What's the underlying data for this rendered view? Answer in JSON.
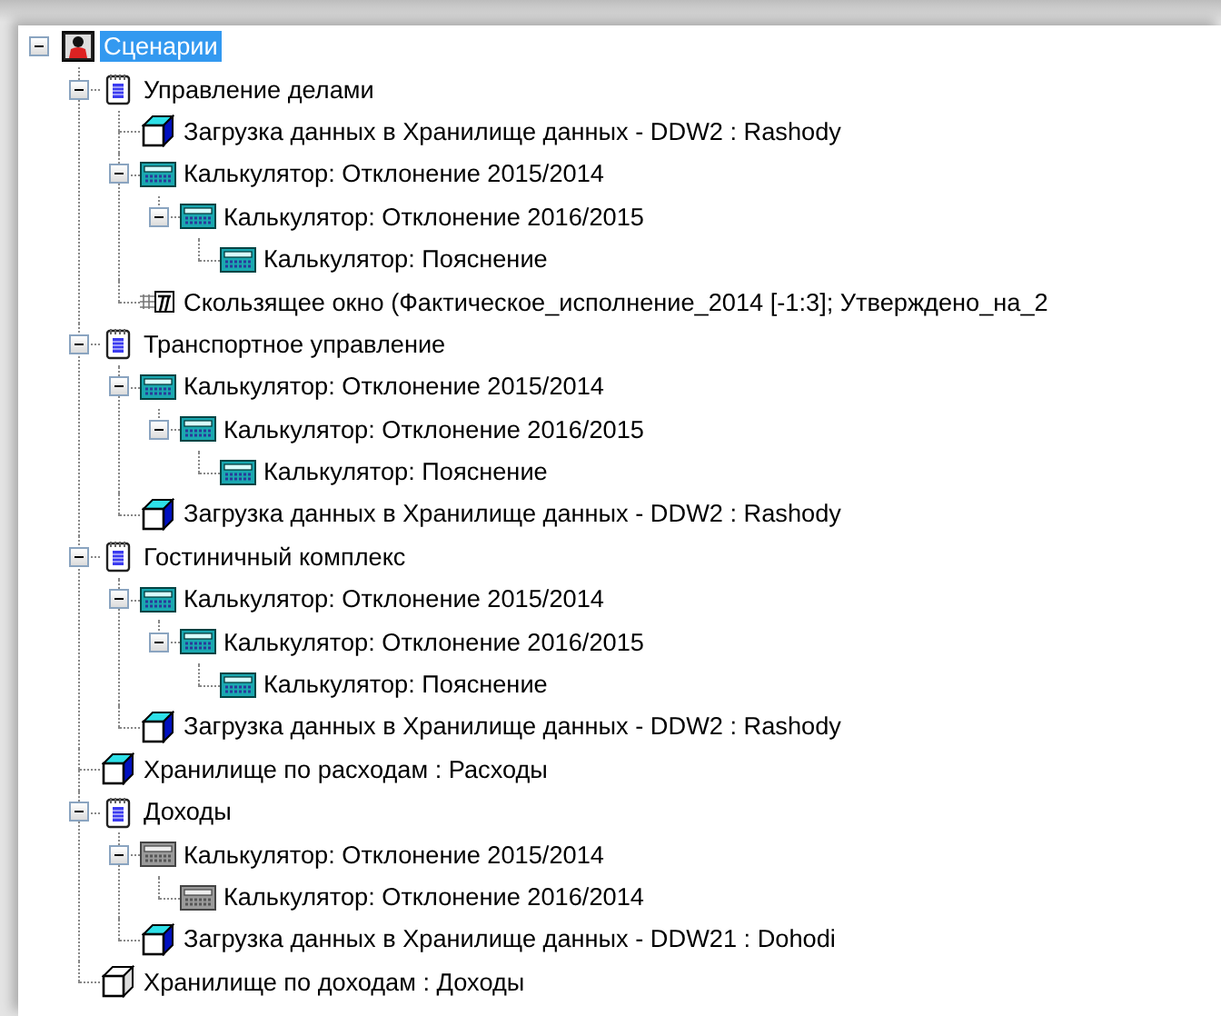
{
  "tree": {
    "nodes": [
      {
        "label": "Сценарии",
        "kind": "root",
        "selected": true,
        "expanded": true,
        "children": [
          {
            "label": "Управление делами",
            "kind": "scenario",
            "selected": false,
            "expanded": true,
            "children": [
              {
                "label": "Загрузка данных в Хранилище данных - DDW2 : Rashody",
                "kind": "cube",
                "selected": false
              },
              {
                "label": "Калькулятор: Отклонение 2015/2014",
                "kind": "calculator",
                "selected": false,
                "expanded": true,
                "children": [
                  {
                    "label": "Калькулятор: Отклонение 2016/2015",
                    "kind": "calculator",
                    "selected": false,
                    "expanded": true,
                    "children": [
                      {
                        "label": "Калькулятор: Пояснение",
                        "kind": "calculator",
                        "selected": false
                      }
                    ]
                  }
                ]
              },
              {
                "label": "Скользящее окно (Фактическое_исполнение_2014 [-1:3]; Утверждено_на_2",
                "kind": "window",
                "selected": false
              }
            ]
          },
          {
            "label": "Транспортное управление",
            "kind": "scenario",
            "selected": false,
            "expanded": true,
            "children": [
              {
                "label": "Калькулятор: Отклонение 2015/2014",
                "kind": "calculator",
                "selected": false,
                "expanded": true,
                "children": [
                  {
                    "label": "Калькулятор: Отклонение 2016/2015",
                    "kind": "calculator",
                    "selected": false,
                    "expanded": true,
                    "children": [
                      {
                        "label": "Калькулятор: Пояснение",
                        "kind": "calculator",
                        "selected": false
                      }
                    ]
                  }
                ]
              },
              {
                "label": "Загрузка данных в Хранилище данных - DDW2 : Rashody",
                "kind": "cube",
                "selected": false
              }
            ]
          },
          {
            "label": "Гостиничный комплекс",
            "kind": "scenario",
            "selected": false,
            "expanded": true,
            "children": [
              {
                "label": "Калькулятор: Отклонение 2015/2014",
                "kind": "calculator",
                "selected": false,
                "expanded": true,
                "children": [
                  {
                    "label": "Калькулятор: Отклонение 2016/2015",
                    "kind": "calculator",
                    "selected": false,
                    "expanded": true,
                    "children": [
                      {
                        "label": "Калькулятор: Пояснение",
                        "kind": "calculator",
                        "selected": false
                      }
                    ]
                  }
                ]
              },
              {
                "label": "Загрузка данных в Хранилище данных - DDW2 : Rashody",
                "kind": "cube",
                "selected": false
              }
            ]
          },
          {
            "label": "Хранилище по расходам : Расходы",
            "kind": "cube",
            "selected": false
          },
          {
            "label": "Доходы",
            "kind": "scenario",
            "selected": false,
            "expanded": true,
            "children": [
              {
                "label": "Калькулятор: Отклонение 2015/2014",
                "kind": "calculator-inactive",
                "selected": false,
                "expanded": true,
                "children": [
                  {
                    "label": "Калькулятор: Отклонение 2016/2014",
                    "kind": "calculator-inactive",
                    "selected": false
                  }
                ]
              },
              {
                "label": "Загрузка данных в Хранилище данных - DDW21 : Dohodi",
                "kind": "cube",
                "selected": false
              }
            ]
          },
          {
            "label": "Хранилище по доходам : Доходы",
            "kind": "cube-inactive",
            "selected": false
          }
        ]
      }
    ]
  }
}
